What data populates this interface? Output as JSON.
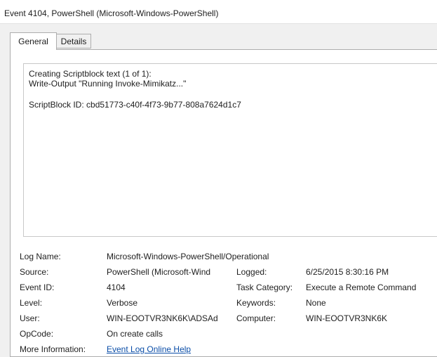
{
  "window": {
    "title": "Event 4104, PowerShell (Microsoft-Windows-PowerShell)"
  },
  "tabs": [
    {
      "label": "General",
      "selected": true
    },
    {
      "label": "Details",
      "selected": false
    }
  ],
  "message": {
    "line1": "Creating Scriptblock text (1 of 1):",
    "line2": "Write-Output \"Running Invoke-Mimikatz...\"",
    "line3": "ScriptBlock ID: cbd51773-c40f-4f73-9b77-808a7624d1c7"
  },
  "fields": {
    "log_name": {
      "label": "Log Name:",
      "value": "Microsoft-Windows-PowerShell/Operational"
    },
    "source": {
      "label": "Source:",
      "value": "PowerShell (Microsoft-Wind"
    },
    "logged": {
      "label": "Logged:",
      "value": "6/25/2015 8:30:16 PM"
    },
    "event_id": {
      "label": "Event ID:",
      "value": "4104"
    },
    "task_category": {
      "label": "Task Category:",
      "value": "Execute a Remote Command"
    },
    "level": {
      "label": "Level:",
      "value": "Verbose"
    },
    "keywords": {
      "label": "Keywords:",
      "value": "None"
    },
    "user": {
      "label": "User:",
      "value": "WIN-EOOTVR3NK6K\\ADSAd"
    },
    "computer": {
      "label": "Computer:",
      "value": "WIN-EOOTVR3NK6K"
    },
    "opcode": {
      "label": "OpCode:",
      "value": "On create calls"
    },
    "more_info": {
      "label": "More Information:",
      "link": "Event Log Online Help"
    }
  },
  "colors": {
    "link": "#0b4ea8",
    "background": "#f0f0f0",
    "panel": "#ffffff",
    "border": "#adadad"
  }
}
